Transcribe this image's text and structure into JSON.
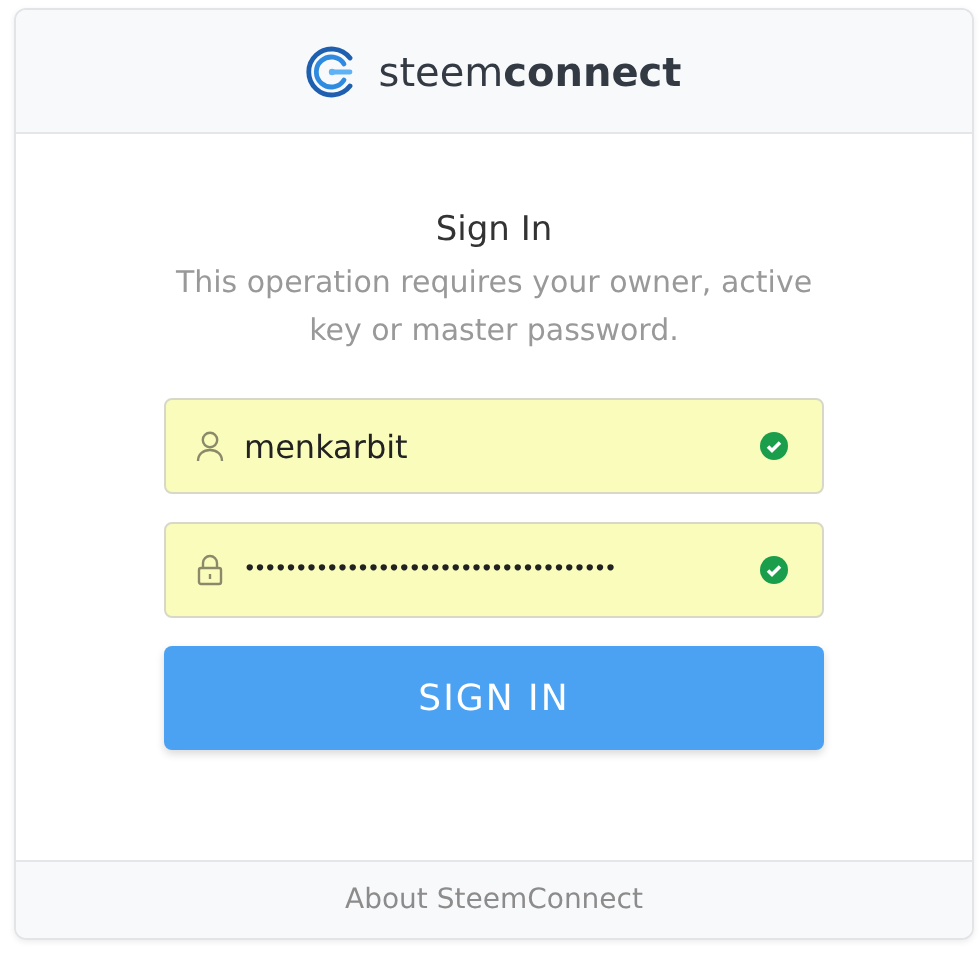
{
  "header": {
    "logo_text": "steem**connect**"
  },
  "title": "Sign In",
  "description": "This operation requires your owner, active key or master password.",
  "fields": [
    {
      "kind": "user",
      "value": "menkarbit",
      "valid": true
    },
    {
      "kind": "password",
      "value": "••••••••••••••••••••••••••••••••••••",
      "valid": true
    }
  ],
  "submit": "SIGN IN",
  "footer": {
    "link": "About SteemConnect"
  }
}
